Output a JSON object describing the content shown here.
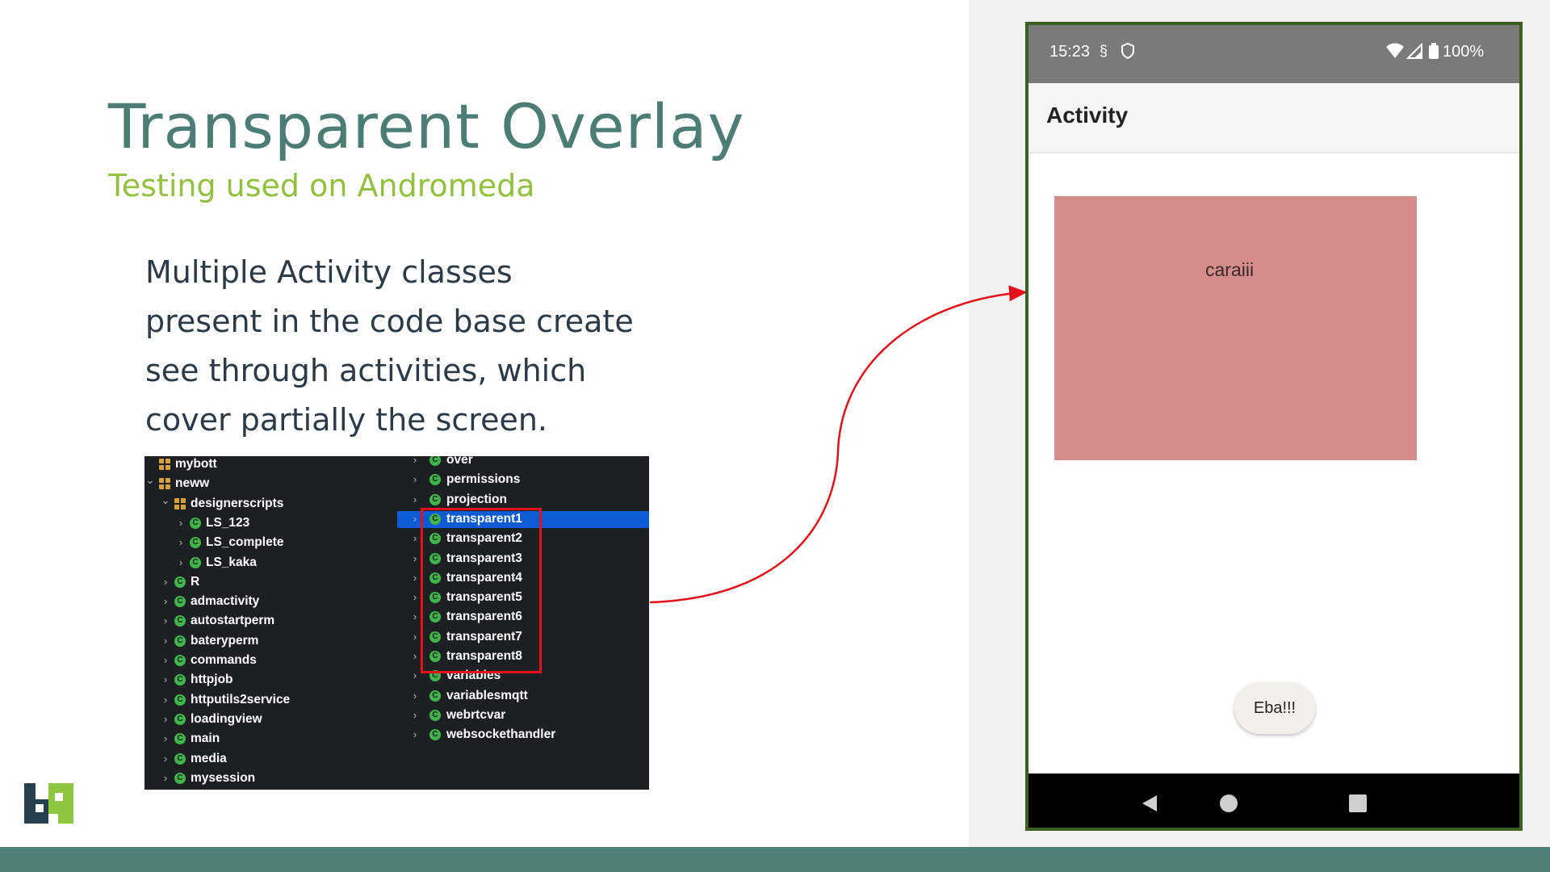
{
  "slide": {
    "title": "Transparent Overlay",
    "subtitle": "Testing used on Andromeda",
    "body_lines": [
      "Multiple Activity classes",
      "present in the code base create",
      "see through activities, which",
      "cover partially the screen."
    ]
  },
  "project_tree": {
    "left_column": [
      {
        "label": "mybott",
        "icon": "package-icon",
        "expanded": "none"
      },
      {
        "label": "neww",
        "icon": "package-icon",
        "expanded": "open"
      },
      {
        "label": "designerscripts",
        "icon": "package-icon",
        "expanded": "open"
      },
      {
        "label": "LS_123",
        "icon": "class-icon",
        "expanded": "closed"
      },
      {
        "label": "LS_complete",
        "icon": "class-icon",
        "expanded": "closed"
      },
      {
        "label": "LS_kaka",
        "icon": "class-icon",
        "expanded": "closed"
      },
      {
        "label": "R",
        "icon": "class-icon",
        "expanded": "closed"
      },
      {
        "label": "admactivity",
        "icon": "class-icon",
        "expanded": "closed"
      },
      {
        "label": "autostartperm",
        "icon": "class-icon",
        "expanded": "closed"
      },
      {
        "label": "bateryperm",
        "icon": "class-icon",
        "expanded": "closed"
      },
      {
        "label": "commands",
        "icon": "class-icon",
        "expanded": "closed"
      },
      {
        "label": "httpjob",
        "icon": "class-icon",
        "expanded": "closed"
      },
      {
        "label": "httputils2service",
        "icon": "class-icon",
        "expanded": "closed"
      },
      {
        "label": "loadingview",
        "icon": "class-icon",
        "expanded": "closed"
      },
      {
        "label": "main",
        "icon": "class-icon",
        "expanded": "closed"
      },
      {
        "label": "media",
        "icon": "class-icon",
        "expanded": "closed"
      },
      {
        "label": "mysession",
        "icon": "class-icon",
        "expanded": "closed"
      }
    ],
    "right_column": [
      {
        "label": "over",
        "icon": "class-icon"
      },
      {
        "label": "permissions",
        "icon": "class-icon"
      },
      {
        "label": "projection",
        "icon": "class-icon"
      },
      {
        "label": "transparent1",
        "icon": "class-icon",
        "selected": true
      },
      {
        "label": "transparent2",
        "icon": "class-icon"
      },
      {
        "label": "transparent3",
        "icon": "class-icon"
      },
      {
        "label": "transparent4",
        "icon": "class-icon"
      },
      {
        "label": "transparent5",
        "icon": "class-icon"
      },
      {
        "label": "transparent6",
        "icon": "class-icon"
      },
      {
        "label": "transparent7",
        "icon": "class-icon"
      },
      {
        "label": "transparent8",
        "icon": "class-icon"
      },
      {
        "label": "variables",
        "icon": "class-icon"
      },
      {
        "label": "variablesmqtt",
        "icon": "class-icon"
      },
      {
        "label": "webrtcvar",
        "icon": "class-icon"
      },
      {
        "label": "websockethandler",
        "icon": "class-icon"
      }
    ],
    "class_icon_letter": "C"
  },
  "phone": {
    "status_bar": {
      "time": "15:23",
      "battery": "100%",
      "icons": [
        "sync-icon",
        "shield-icon",
        "wifi-icon",
        "signal-icon",
        "battery-icon"
      ]
    },
    "app_bar_title": "Activity",
    "overlay_text": "caraiii",
    "toast_text": "Eba!!!",
    "nav_buttons": [
      "back-icon",
      "home-icon",
      "recents-icon"
    ]
  },
  "colors": {
    "title": "#4c7d74",
    "subtitle": "#92c13e",
    "body_text": "#2b3a48",
    "bottom_bar": "#4e7e79",
    "ide_background": "#1e1f22",
    "selection": "#0e5cd3",
    "highlight_box": "#e3121a",
    "phone_border": "#3b5f20",
    "overlay_pink": "#d78c8c",
    "arrow": "#e3121a"
  }
}
